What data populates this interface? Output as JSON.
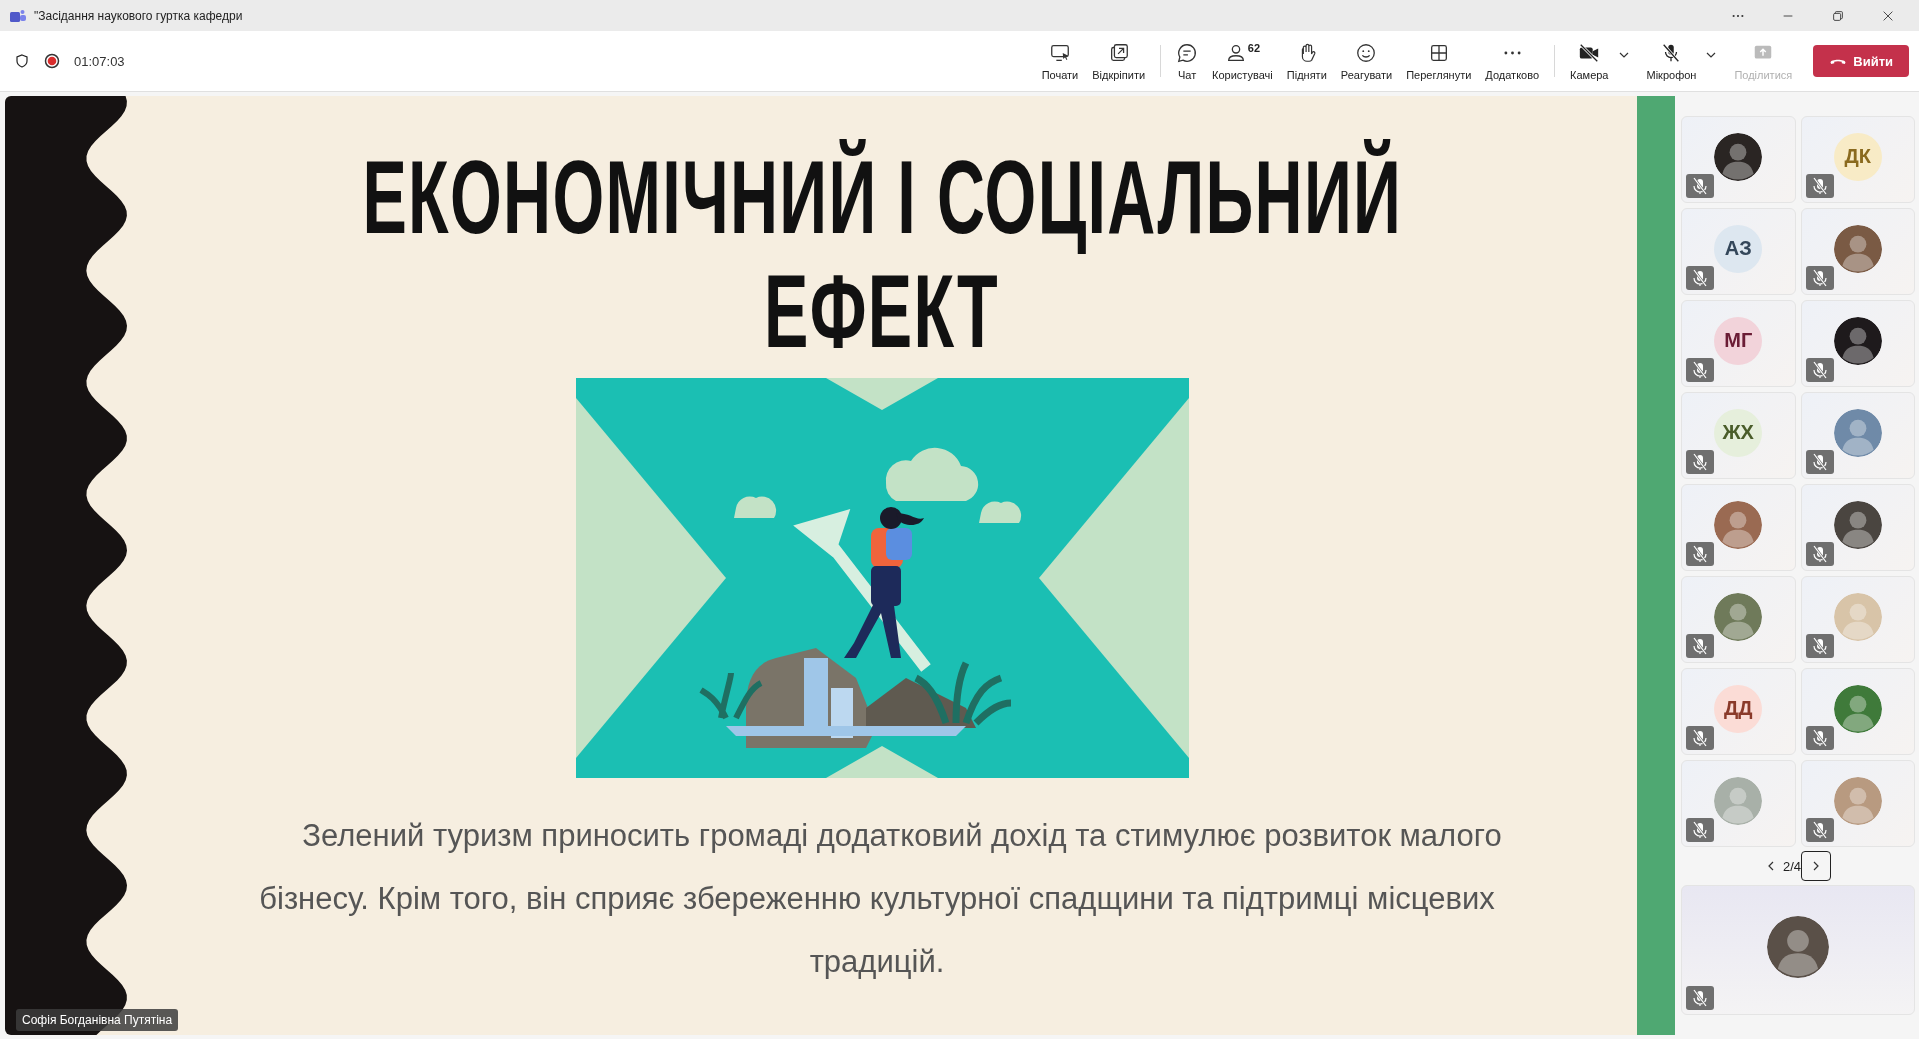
{
  "window": {
    "title": "\"Засідання наукового гуртка кафедри"
  },
  "meeting": {
    "recording": true,
    "timer": "01:07:03"
  },
  "toolbar": [
    {
      "kind": "share-screen",
      "label": "Почати",
      "has_menu": false,
      "disabled": false
    },
    {
      "kind": "pop-out",
      "label": "Відкріпити",
      "has_menu": false,
      "disabled": false
    },
    {
      "kind": "chat",
      "label": "Чат",
      "has_menu": false,
      "disabled": false
    },
    {
      "kind": "people",
      "label": "Користувачі",
      "count": "62",
      "has_menu": false,
      "disabled": false
    },
    {
      "kind": "hand",
      "label": "Підняти",
      "has_menu": false,
      "disabled": false
    },
    {
      "kind": "react",
      "label": "Реагувати",
      "has_menu": false,
      "disabled": false
    },
    {
      "kind": "view",
      "label": "Переглянути",
      "has_menu": false,
      "disabled": false
    },
    {
      "kind": "more",
      "label": "Додатково",
      "has_menu": false,
      "disabled": false
    },
    {
      "kind": "camera",
      "label": "Камера",
      "has_menu": true,
      "disabled": false
    },
    {
      "kind": "mic",
      "label": "Мікрофон",
      "has_menu": true,
      "disabled": false
    },
    {
      "kind": "share",
      "label": "Поділитися",
      "has_menu": false,
      "disabled": true
    }
  ],
  "leave_button": {
    "label": "Вийти"
  },
  "slide": {
    "title_lines": [
      "ЕКОНОМІЧНИЙ І СОЦІАЛЬНИЙ",
      "ЕФЕКТ"
    ],
    "paragraph": "Зелений туризм приносить громаді додатковий дохід та стимулює розвиток малого бізнесу. Крім того, він сприяє збереженню культурної спадщини та підтримці місцевих традицій.",
    "presenter": "Софія Богданівна Путятіна"
  },
  "participants": [
    {
      "kind": "photo",
      "color": "#2a2523",
      "muted": true
    },
    {
      "kind": "initials",
      "initials": "ДК",
      "color": "#f8ebc6",
      "muted": true
    },
    {
      "kind": "initials",
      "initials": "АЗ",
      "color": "#dde7f0",
      "muted": true
    },
    {
      "kind": "photo",
      "color": "#7a5a44",
      "muted": true
    },
    {
      "kind": "initials",
      "initials": "МГ",
      "color": "#f2d3da",
      "muted": true
    },
    {
      "kind": "photo",
      "color": "#1e1a1c",
      "muted": true
    },
    {
      "kind": "initials",
      "initials": "ЖХ",
      "color": "#e6efdc",
      "muted": true
    },
    {
      "kind": "photo",
      "color": "#6f8aa8",
      "muted": true
    },
    {
      "kind": "photo",
      "color": "#9a6a52",
      "muted": true
    },
    {
      "kind": "photo",
      "color": "#4a4540",
      "muted": true
    },
    {
      "kind": "photo",
      "color": "#6f7a5a",
      "muted": true
    },
    {
      "kind": "photo",
      "color": "#d8c4a8",
      "muted": true
    },
    {
      "kind": "initials",
      "initials": "ДД",
      "color": "#fbdcd6",
      "muted": true
    },
    {
      "kind": "photo",
      "color": "#3f7a3a",
      "muted": true
    },
    {
      "kind": "photo",
      "color": "#a8b0a8",
      "muted": true
    },
    {
      "kind": "photo",
      "color": "#b89a80",
      "muted": true
    }
  ],
  "pager": {
    "text": "2/4"
  },
  "self_tile": {
    "kind": "photo",
    "color": "#5a5048",
    "muted": true
  }
}
